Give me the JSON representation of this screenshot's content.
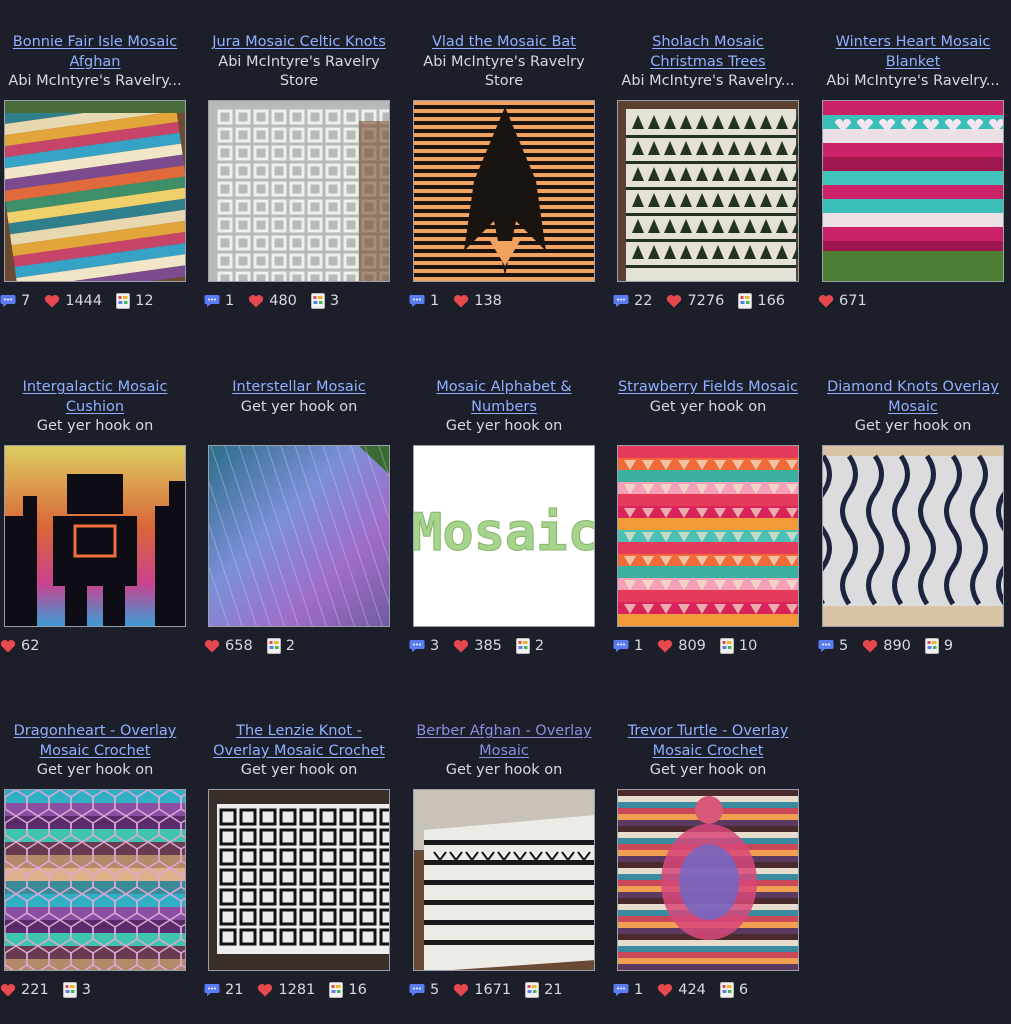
{
  "patterns": [
    {
      "title": "Bonnie Fair Isle Mosaic Afghan",
      "author": "Abi McIntyre's Ravelry...",
      "comments": "7",
      "likes": "1444",
      "projects": "12",
      "image": "striped-afghan"
    },
    {
      "title": "Jura Mosaic Celtic Knots",
      "author": "Abi McIntyre's Ravelry Store",
      "comments": "1",
      "likes": "480",
      "projects": "3",
      "image": "celtic-knot-blanket"
    },
    {
      "title": "Vlad the Mosaic Bat",
      "author": "Abi McIntyre's Ravelry Store",
      "comments": "1",
      "likes": "138",
      "projects": "",
      "image": "bat-blanket"
    },
    {
      "title": "Sholach Mosaic Christmas Trees",
      "author": "Abi McIntyre's Ravelry...",
      "comments": "22",
      "likes": "7276",
      "projects": "166",
      "image": "christmas-tree-blanket"
    },
    {
      "title": "Winters Heart Mosaic Blanket",
      "author": "Abi McIntyre's Ravelry...",
      "comments": "",
      "likes": "671",
      "projects": "",
      "image": "heart-blanket"
    },
    {
      "title": "Intergalactic Mosaic Cushion",
      "author": "Get yer hook on",
      "comments": "",
      "likes": "62",
      "projects": "",
      "image": "robot-cushion"
    },
    {
      "title": "Interstellar Mosaic",
      "author": "Get yer hook on",
      "comments": "",
      "likes": "658",
      "projects": "2",
      "image": "gradient-blanket"
    },
    {
      "title": "Mosaic Alphabet & Numbers",
      "author": "Get yer hook on",
      "comments": "3",
      "likes": "385",
      "projects": "2",
      "image": "mosaic-text",
      "image_text": "Mosaic"
    },
    {
      "title": "Strawberry Fields Mosaic",
      "author": "Get yer hook on",
      "comments": "1",
      "likes": "809",
      "projects": "10",
      "image": "strawberry-blanket"
    },
    {
      "title": "Diamond Knots Overlay Mosaic",
      "author": "Get yer hook on",
      "comments": "5",
      "likes": "890",
      "projects": "9",
      "image": "diamond-knot-blanket"
    },
    {
      "title": "Dragonheart - Overlay Mosaic Crochet",
      "author": "Get yer hook on",
      "comments": "",
      "likes": "221",
      "projects": "3",
      "image": "dragonheart-blanket"
    },
    {
      "title": "The Lenzie Knot - Overlay Mosaic Crochet",
      "author": "Get yer hook on",
      "comments": "21",
      "likes": "1281",
      "projects": "16",
      "image": "lenzie-knot-blanket"
    },
    {
      "title": "Berber Afghan - Overlay Mosaic",
      "author": "Get yer hook on",
      "comments": "5",
      "likes": "1671",
      "projects": "21",
      "image": "berber-afghan"
    },
    {
      "title": "Trevor Turtle - Overlay Mosaic Crochet",
      "author": "Get yer hook on",
      "comments": "1",
      "likes": "424",
      "projects": "6",
      "image": "turtle-blanket"
    }
  ],
  "colors": {
    "background": "#1c1f2a",
    "link": "#8fb0ff",
    "visited_link": "#8a8fe0",
    "heart": "#e5484d",
    "comment": "#5b7cf5"
  }
}
